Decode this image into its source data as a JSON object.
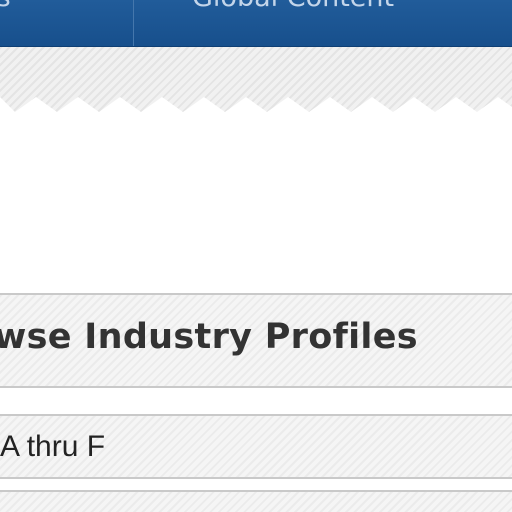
{
  "navbar": {
    "items": [
      {
        "label": "es"
      },
      {
        "label": "Global Content"
      }
    ]
  },
  "section": {
    "title": "wse Industry Profiles"
  },
  "list": {
    "rows": [
      {
        "label": "A thru F"
      },
      {
        "label": ""
      }
    ]
  },
  "colors": {
    "nav_background": "#1a5391",
    "nav_text": "#c3d5ea",
    "heading_text": "#333333",
    "row_border": "#c9c9c9"
  }
}
